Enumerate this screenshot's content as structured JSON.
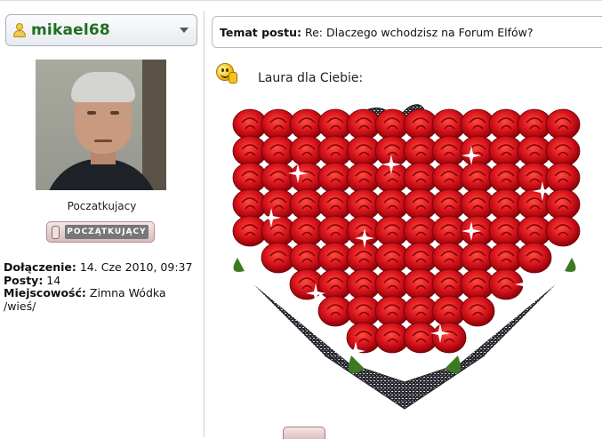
{
  "profile": {
    "username": "mikael68",
    "rank_title": "Poczatkujacy",
    "rank_badge": "POCZĄTKUJĄCY",
    "joined_label": "Dołączenie:",
    "joined_value": "14. Cze 2010, 09:37",
    "posts_label": "Posty:",
    "posts_value": "14",
    "location_label": "Miejscowość:",
    "location_value": "Zimna Wódka /wieś/"
  },
  "post": {
    "subject_label": "Temat postu:",
    "subject_value": "Re: Dlaczego wchodzisz na Forum Elfów?",
    "message": "Laura dla Ciebie:"
  },
  "icons": {
    "user": "user-icon",
    "dropdown": "chevron-down-icon",
    "smiley": "smiley-icon",
    "image": "heart-rose-bouquet"
  },
  "colors": {
    "username": "#1f6f1f",
    "rose": "#d8141c",
    "badge": "#d8bcbc"
  }
}
